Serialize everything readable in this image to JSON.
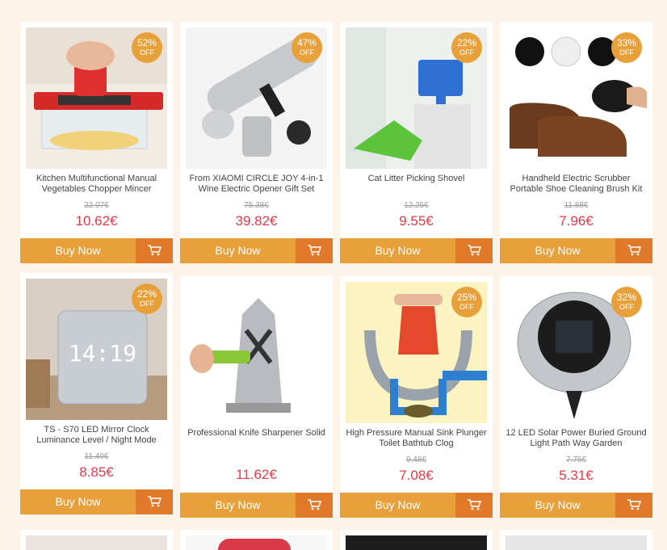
{
  "products": [
    {
      "title": "Kitchen Multifunctional Manual Vegetables Chopper Mincer",
      "discount": "52%",
      "off": "OFF",
      "old_price": "22.07€",
      "price": "10.62€",
      "buy": "Buy Now",
      "icon": "vegetable-chopper"
    },
    {
      "title": "From XIAOMI CIRCLE JOY 4-in-1 Wine Electric Opener Gift Set",
      "discount": "47%",
      "off": "OFF",
      "old_price": "75.38€",
      "price": "39.82€",
      "buy": "Buy Now",
      "icon": "wine-opener"
    },
    {
      "title": "Cat Litter Picking Shovel",
      "discount": "22%",
      "off": "OFF",
      "old_price": "12.25€",
      "price": "9.55€",
      "buy": "Buy Now",
      "icon": "litter-shovel"
    },
    {
      "title": "Handheld Electric Scrubber Portable Shoe Cleaning Brush Kit",
      "discount": "33%",
      "off": "OFF",
      "old_price": "11.88€",
      "price": "7.96€",
      "buy": "Buy Now",
      "icon": "shoe-brush"
    },
    {
      "title": "TS - S70 LED Mirror Clock Luminance Level / Night Mode",
      "discount": "22%",
      "off": "OFF",
      "old_price": "11.40€",
      "price": "8.85€",
      "buy": "Buy Now",
      "icon": "mirror-clock",
      "clock_display": "14:19"
    },
    {
      "title": "Professional Knife Sharpener Solid",
      "price": "11.62€",
      "buy": "Buy Now",
      "icon": "knife-sharpener"
    },
    {
      "title": "High Pressure Manual Sink Plunger Toilet Bathtub Clog",
      "discount": "25%",
      "off": "OFF",
      "old_price": "9.48€",
      "price": "7.08€",
      "buy": "Buy Now",
      "icon": "sink-plunger"
    },
    {
      "title": "12 LED Solar Power Buried Ground Light Path Way Garden",
      "discount": "32%",
      "off": "OFF",
      "old_price": "7.75€",
      "price": "5.31€",
      "buy": "Buy Now",
      "icon": "solar-light"
    }
  ],
  "colors": {
    "accent": "#e8a13a",
    "cart": "#e07a2a",
    "price": "#e23a4b",
    "background": "#fdf3e8"
  }
}
